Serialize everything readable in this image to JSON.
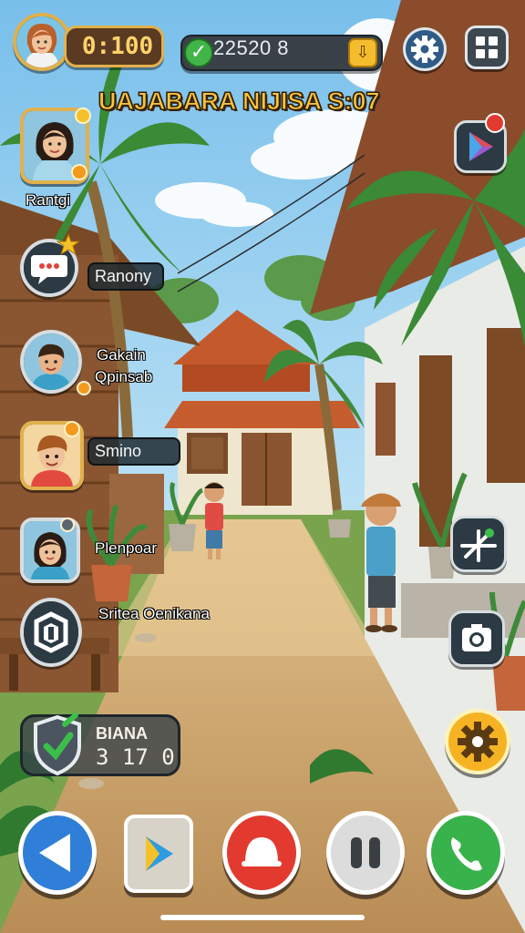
{
  "hud": {
    "timer": "0:100",
    "coins": "22520 8",
    "player_avatar_icon": "player-portrait-icon",
    "settings_icon": "gear-icon",
    "menu_icon": "grid-icon"
  },
  "title": "UAJABARA NIJISA S:07",
  "left_menu": {
    "items": [
      {
        "label": "Rantgi",
        "icon": "portrait-woman-icon"
      },
      {
        "label": "Ranony",
        "icon": "chat-bubble-icon"
      },
      {
        "label_line1": "Gakain",
        "label_line2": "Qpinsab",
        "icon": "portrait-man-icon"
      },
      {
        "label": "Smino",
        "icon": "portrait-boy-icon"
      },
      {
        "label": "Plenpoar",
        "icon": "portrait-girl-icon"
      },
      {
        "label": "Sritea Oenikana",
        "icon": "shield-emblem-icon"
      }
    ],
    "stat": {
      "line1": "BIANA",
      "line2": "3 17 0",
      "icon": "shield-check-icon"
    }
  },
  "right_menu": {
    "play_icon": "play-store-icon",
    "map_icon": "map-icon",
    "camera_icon": "camera-icon",
    "settings_icon": "gear-icon"
  },
  "bottom_bar": {
    "back_icon": "back-arrow-icon",
    "play_icon": "play-icon",
    "bell_icon": "bell-icon",
    "pause_icon": "pause-icon",
    "call_icon": "phone-icon"
  },
  "colors": {
    "hud_gold": "#e2b04c",
    "title_yellow": "#f6c43a",
    "back_blue": "#2f7fd8",
    "bell_red": "#e23a2f",
    "call_green": "#38b24a",
    "gear_yellow": "#f5b324"
  }
}
